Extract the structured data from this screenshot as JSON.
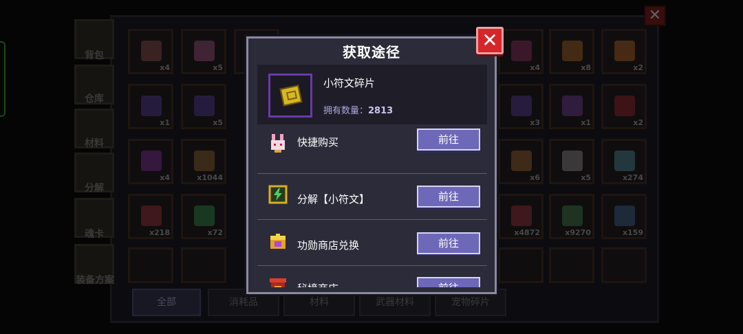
{
  "inventory": {
    "side_tabs": [
      "背包",
      "仓库",
      "材料",
      "分解",
      "魂卡",
      "装备方案"
    ],
    "cells": [
      {
        "count": "x4",
        "color": "#b06060"
      },
      {
        "count": "x5",
        "color": "#c06aa0"
      },
      {
        "count": "",
        "color": "#555"
      },
      {
        "count": "",
        "color": "#555"
      },
      {
        "count": "",
        "color": "#555"
      },
      {
        "count": "",
        "color": "#555"
      },
      {
        "count": "x4",
        "color": "#b04080"
      },
      {
        "count": "x8",
        "color": "#d08030"
      },
      {
        "count": "x2",
        "color": "#e08030"
      },
      {
        "count": "x1",
        "color": "#6a50c0"
      },
      {
        "count": "x5",
        "color": "#6a50c0"
      },
      {
        "count": "x3",
        "color": "#7050c0"
      },
      {
        "count": "x1",
        "color": "#9050c0"
      },
      {
        "count": "x2",
        "color": "#c03040"
      },
      {
        "count": "x4",
        "color": "#a040c0"
      },
      {
        "count": "x1044",
        "color": "#b08040"
      },
      {
        "count": "x6",
        "color": "#c08040"
      },
      {
        "count": "x5",
        "color": "#b0b0b0"
      },
      {
        "count": "x274",
        "color": "#60b0c0"
      },
      {
        "count": "x218",
        "color": "#c04050"
      },
      {
        "count": "x72",
        "color": "#40b060"
      },
      {
        "count": "x4872",
        "color": "#c04050"
      },
      {
        "count": "x9270",
        "color": "#50a060"
      },
      {
        "count": "x159",
        "color": "#5080b0"
      }
    ],
    "bottom_tabs": [
      "全部",
      "消耗品",
      "材料",
      "武器材料",
      "宠物碎片"
    ],
    "close_label": "✕"
  },
  "modal": {
    "title": "获取途径",
    "close_label": "✕",
    "item_name": "小符文碎片",
    "owned_label": "拥有数量：",
    "owned_count": "2813",
    "options": [
      {
        "label": "快捷购买",
        "button": "前往",
        "icon": "shop-bunny-icon"
      },
      {
        "label": "分解【小符文】",
        "button": "前往",
        "icon": "dismantle-icon"
      },
      {
        "label": "功勋商店兑换",
        "button": "前往",
        "icon": "merit-shop-icon"
      },
      {
        "label": "秘境商店",
        "button": "前往",
        "icon": "secret-realm-shop-icon"
      }
    ]
  }
}
